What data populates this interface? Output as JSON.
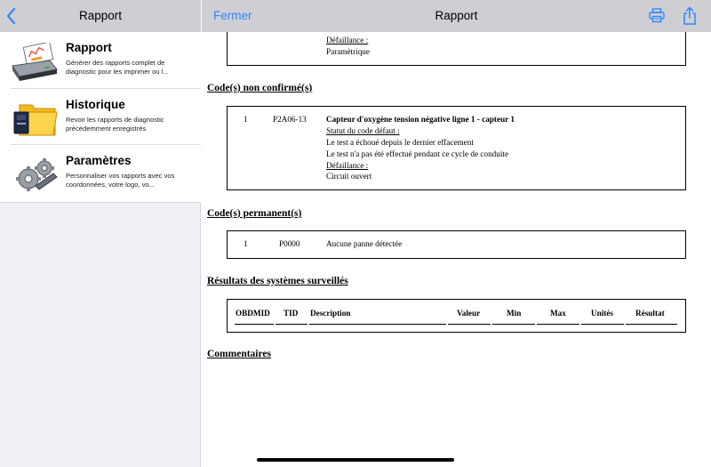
{
  "sidebar": {
    "title": "Rapport",
    "items": [
      {
        "title": "Rapport",
        "desc": "Générer des rapports complet de diagnostic pour les imprimer ou l...",
        "icon": "printer-report-icon"
      },
      {
        "title": "Historique",
        "desc": "Revoir les rapports de diagnostic précédemment enregistrés",
        "icon": "folder-history-icon"
      },
      {
        "title": "Paramètres",
        "desc": "Personnaliser vos rapports avec vos coordonnées, votre logo, vo...",
        "icon": "gears-settings-icon"
      }
    ]
  },
  "header": {
    "close_label": "Fermer",
    "title": "Rapport",
    "accent": "#2f86f7"
  },
  "report": {
    "top_box": {
      "fault_label": "Défaillance :",
      "fault_value": "Paramètrique"
    },
    "unconfirmed": {
      "title": "Code(s) non confirmé(s)",
      "index": "1",
      "code": "P2A06-13",
      "name": "Capteur d'oxygène tension négative ligne 1 - capteur 1",
      "status_label": "Statut du code défaut :",
      "status_line1": "Le test a échoué depuis le dernier effacement",
      "status_line2": "Le test n'a pas été effectué pendant ce cycle de conduite",
      "fault_label": "Défaillance :",
      "fault_value": "Circuit ouvert"
    },
    "permanent": {
      "title": "Code(s) permanent(s)",
      "index": "1",
      "code": "P0000",
      "desc": "Aucune panne détectée"
    },
    "monitored": {
      "title": "Résultats des systèmes surveillés",
      "columns": [
        "OBDMID",
        "TID",
        "Description",
        "Valeur",
        "Min",
        "Max",
        "Unités",
        "Résultat"
      ]
    },
    "comments": {
      "title": "Commentaires"
    }
  }
}
